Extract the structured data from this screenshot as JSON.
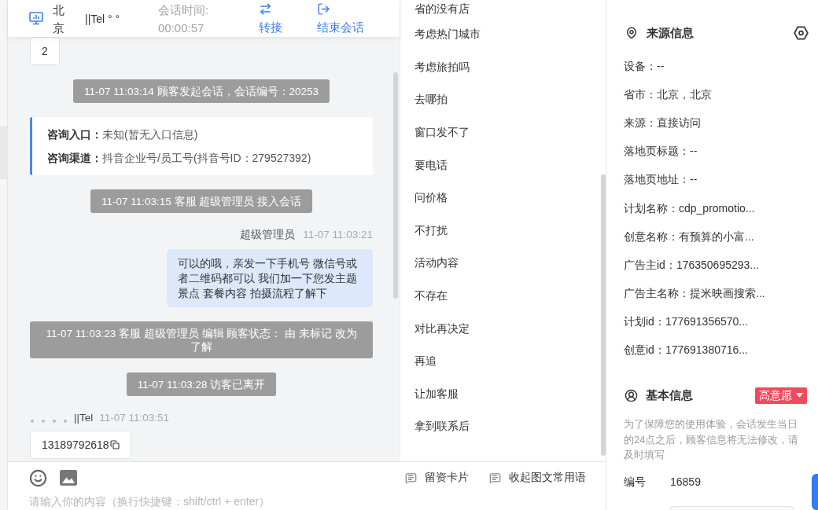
{
  "header": {
    "location": "北京",
    "visitor_name": "||Tel ° °",
    "session_time_label": "会话时间:",
    "session_time": "00:00:57",
    "actions": [
      {
        "kind": "transfer",
        "label": "转接"
      },
      {
        "kind": "end",
        "label": "结束会话"
      }
    ]
  },
  "messages": [
    {
      "kind": "visitor",
      "text": "2",
      "copyable": false
    },
    {
      "kind": "system",
      "text": "11-07 11:03:14 顾客发起会话，会话编号：20253"
    },
    {
      "kind": "entry_card",
      "lines": [
        {
          "label": "咨询入口：",
          "value": "未知(暂无入口信息)"
        },
        {
          "label": "咨询渠道：",
          "value": "抖音企业号/员工号(抖音号ID：279527392)"
        }
      ]
    },
    {
      "kind": "system",
      "text": "11-07 11:03:15 客服 超级管理员 接入会话"
    },
    {
      "kind": "agent",
      "sender": "超级管理员",
      "time": "11-07 11:03:21",
      "text": "可以的哦，亲发一下手机号 微信号或者二维码都可以 我们加一下您发主题景点 套餐内容 拍摄流程了解下"
    },
    {
      "kind": "system",
      "text": "11-07 11:03:23 客服 超级管理员 编辑 顾客状态： 由 未标记 改为了解"
    },
    {
      "kind": "system",
      "text": "11-07 11:03:28 访客已离开"
    },
    {
      "kind": "visitor",
      "sender": "。。。。||Tel",
      "time": "11-07 11:03:51",
      "text": "13189792618",
      "copyable": true
    }
  ],
  "quick_phrases": [
    "省的没有店",
    "考虑热门城市",
    "考虑旅拍吗",
    "去哪拍",
    "窗口发不了",
    "要电话",
    "问价格",
    "不打扰",
    "活动内容",
    "不存在",
    "对比再决定",
    "再追",
    "让加客服",
    "拿到联系后"
  ],
  "composer": {
    "tools": [
      {
        "label": "留资卡片"
      },
      {
        "label": "收起图文常用语"
      }
    ],
    "placeholder": "请输入你的内容（换行快捷键：shift/ctrl + enter）"
  },
  "source_info": {
    "title": "来源信息",
    "rows": [
      "设备：--",
      "省市：北京，北京",
      "来源：直接访问",
      "落地页标题：--",
      "落地页地址：--",
      "计划名称：cdp_promotio...",
      "创意名称：有预算的小富...",
      "广告主id：176350695293...",
      "广告主名称：提米映画搜索...",
      "计划id：177691356570...",
      "创意id：177691380716..."
    ]
  },
  "basic_info": {
    "title": "基本信息",
    "intent_tag": "高意愿",
    "note": "为了保障您的使用体验，会话发生当日的24点之后，顾客信息将无法修改，请及时填写",
    "fields": [
      {
        "label": "编号",
        "value": "16859"
      }
    ]
  }
}
